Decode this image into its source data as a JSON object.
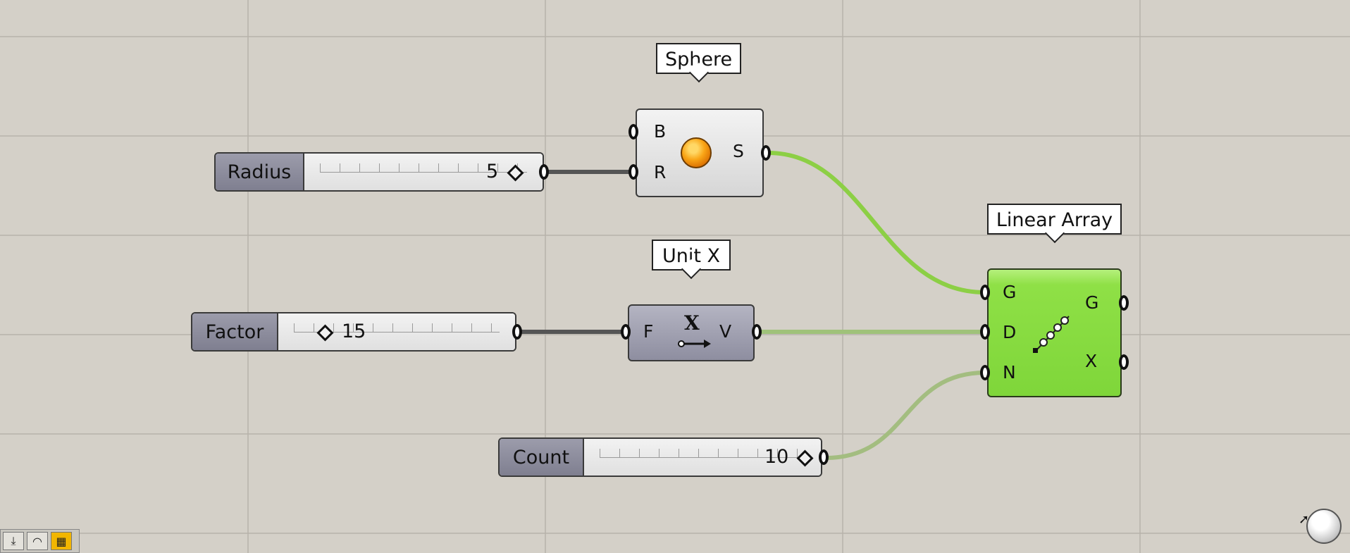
{
  "callouts": {
    "sphere": "Sphere",
    "unit_x": "Unit X",
    "linear_array": "Linear Array"
  },
  "sliders": {
    "radius": {
      "label": "Radius",
      "value": "5"
    },
    "factor": {
      "label": "Factor",
      "value": "15"
    },
    "count": {
      "label": "Count",
      "value": "10"
    }
  },
  "components": {
    "sphere": {
      "inputs": [
        "B",
        "R"
      ],
      "outputs": [
        "S"
      ],
      "icon": "sphere-icon"
    },
    "unit_x": {
      "inputs": [
        "F"
      ],
      "outputs": [
        "V"
      ],
      "icon": "unit-x-vector-icon",
      "icon_text": "X"
    },
    "linear_array": {
      "inputs": [
        "G",
        "D",
        "N"
      ],
      "outputs": [
        "G",
        "X"
      ],
      "icon": "linear-array-icon"
    }
  },
  "wire_colors": {
    "data": "#555555",
    "geometry": "#8ccf45",
    "faded": "#9fb27f"
  },
  "taskbar": {
    "icons": [
      "download-icon",
      "eye-icon",
      "grasshopper-icon"
    ]
  },
  "navigation": {
    "icon": "navigation-sphere-icon"
  }
}
